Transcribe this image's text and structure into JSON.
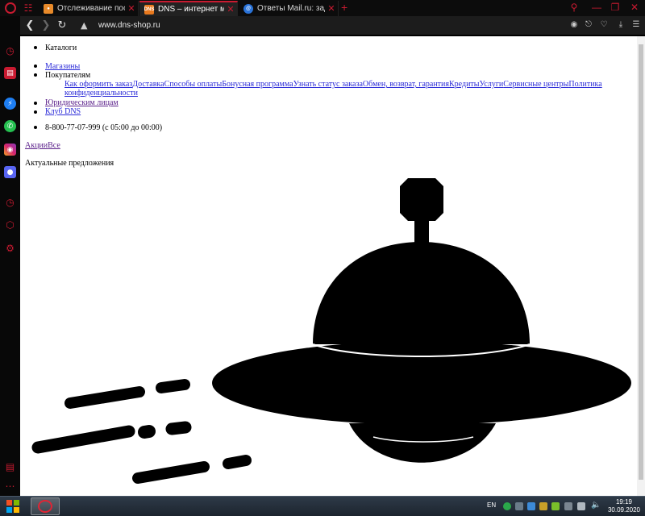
{
  "browser": {
    "tabs": [
      {
        "title": "Отслеживание посылок и",
        "favicon": "package-tracking-favicon"
      },
      {
        "title": "DNS – интернет магазин ц",
        "favicon": "dns-favicon",
        "active": true
      },
      {
        "title": "Ответы Mail.ru: задать воп",
        "favicon": "mailru-favicon"
      }
    ],
    "url": "www.dns-shop.ru",
    "accent": "#c81a30"
  },
  "page": {
    "menu": {
      "catalogs": "Каталоги",
      "stores": "Магазины",
      "buyers": "Покупателям",
      "buyer_links": [
        "Как оформить заказ",
        "Доставка",
        "Способы оплаты",
        "Бонусная программа",
        "Узнать статус заказа",
        "Обмен, возврат, гарантия",
        "Кредиты",
        "Услуги",
        "Сервисные центры",
        "Политика"
      ],
      "buyer_links_cont": "конфиденциальности",
      "legal": "Юридическим лицам",
      "club": "Клуб DNS",
      "phone": "8-800-77-07-999 (с 05:00 до 00:00)"
    },
    "promo_links": [
      "Акции",
      "Все"
    ],
    "promo_heading": "Актуальные предложения",
    "illustration": "ufo-icon"
  },
  "taskbar": {
    "language": "EN",
    "time": "19:19",
    "date": "30.09.2020"
  }
}
